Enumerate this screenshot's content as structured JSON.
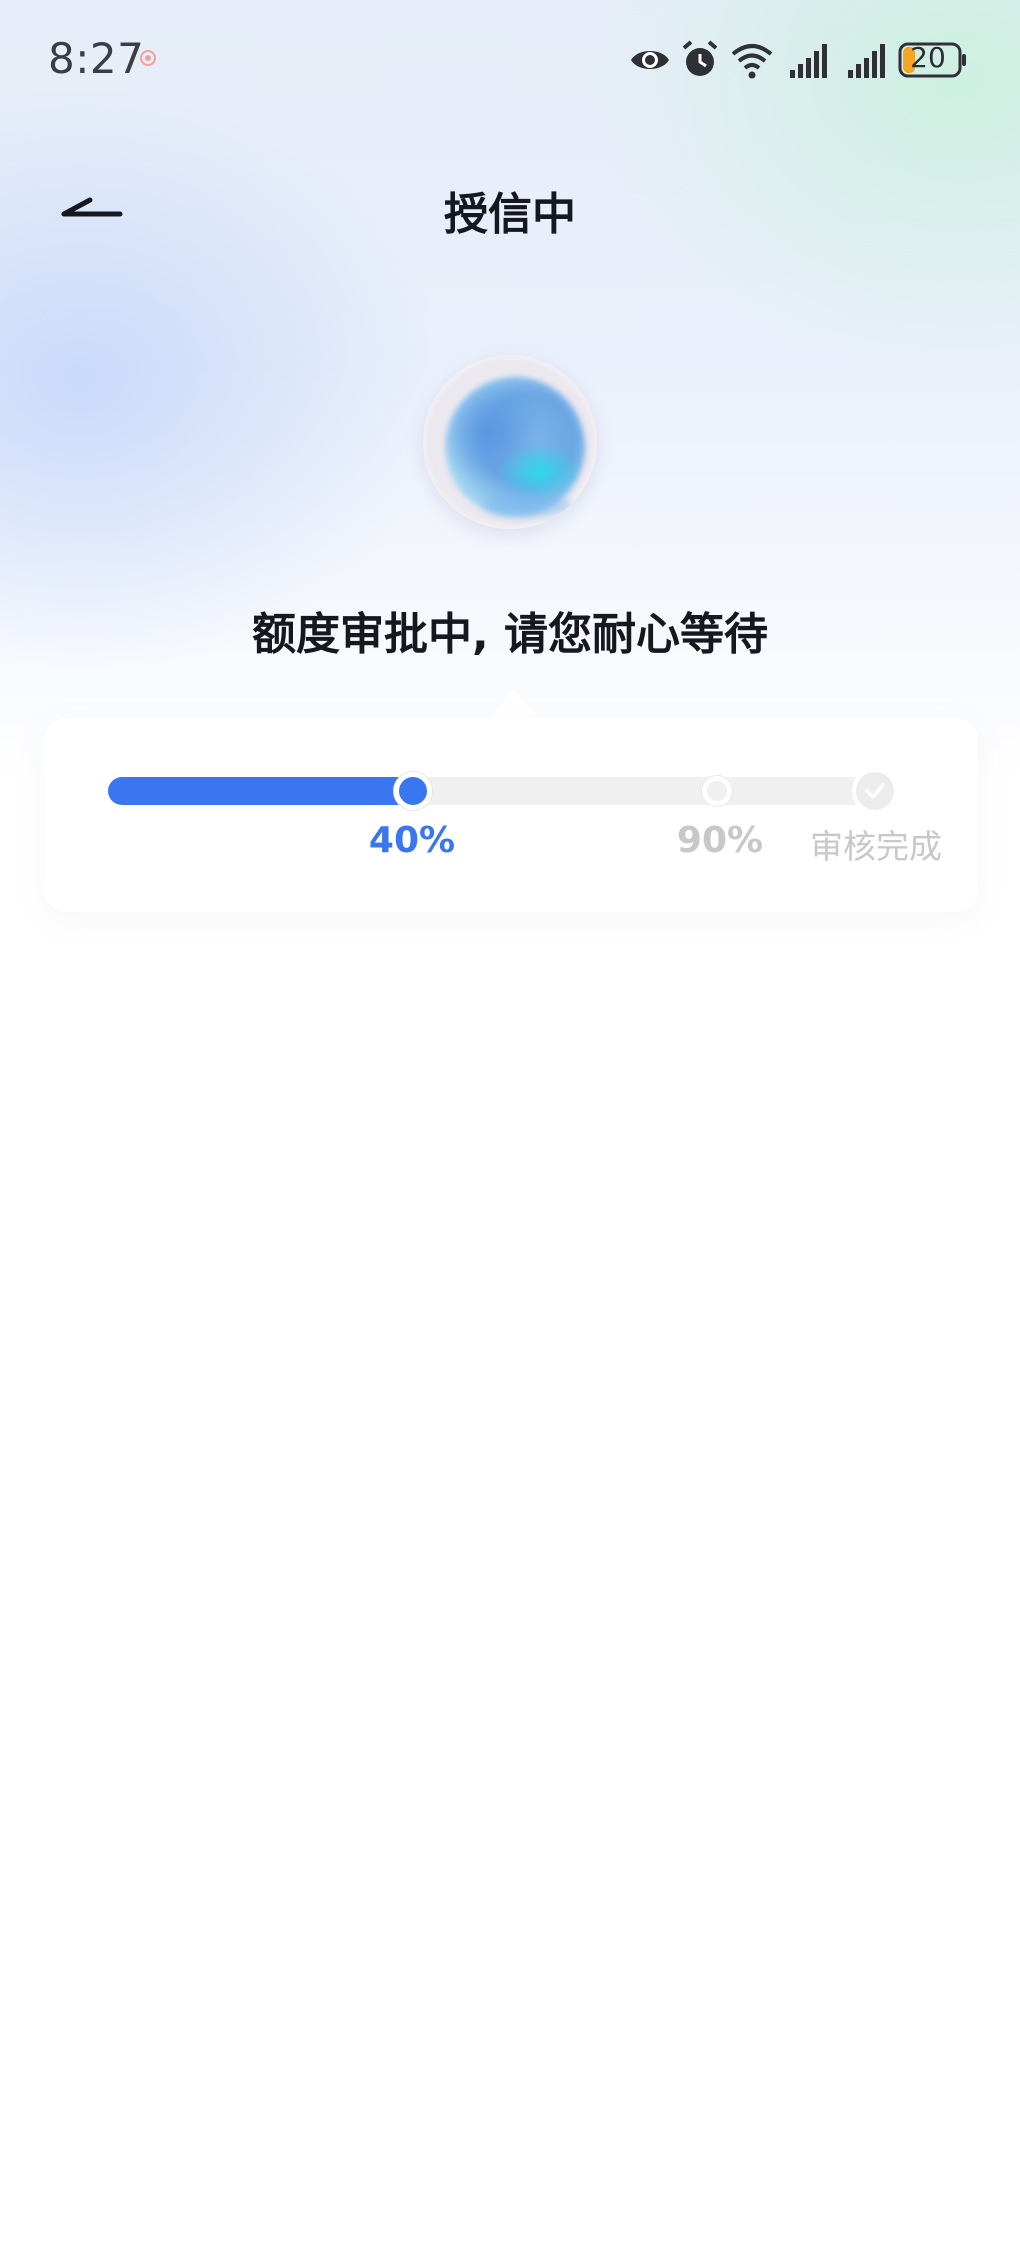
{
  "status_bar": {
    "time": "8:27",
    "battery": "20",
    "icons": [
      "notification-dot-icon",
      "eye-icon",
      "alarm-icon",
      "wifi-icon",
      "signal-icon",
      "signal-icon",
      "battery-icon"
    ]
  },
  "header": {
    "title": "授信中",
    "back_icon": "back-arrow-icon"
  },
  "main": {
    "message": "额度审批中, 请您耐心等待"
  },
  "progress": {
    "value": 0.4,
    "steps": [
      {
        "label": "40%",
        "state": "active"
      },
      {
        "label": "90%",
        "state": "pending"
      },
      {
        "label": "审核完成",
        "state": "pending"
      }
    ]
  },
  "colors": {
    "accent": "#3a76f0",
    "track": "#f0f0f0",
    "inactive_text": "#c8c8c8",
    "title_text": "#15181f",
    "battery_low": "#f5a623"
  }
}
